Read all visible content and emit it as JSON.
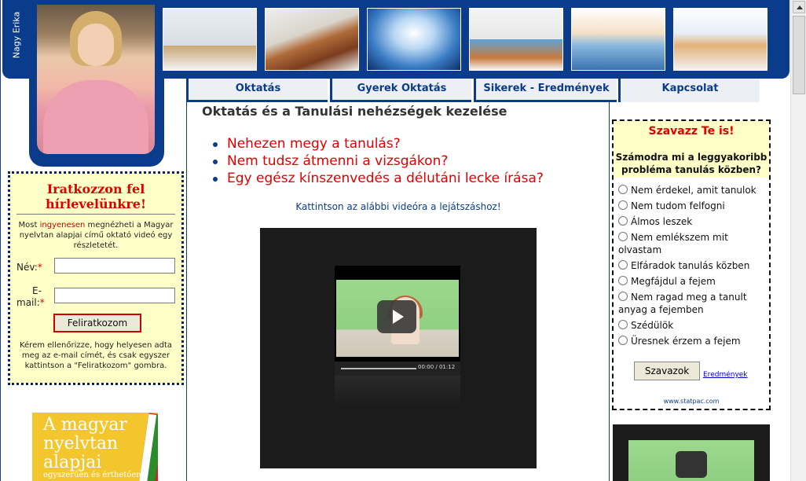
{
  "header": {
    "author_name": "Nagy Erika",
    "photos": [
      "child-frustrated-photo",
      "student-asleep-on-books-photo",
      "glowing-open-book-photo",
      "kids-reading-photo",
      "girl-smiling-with-books-photo",
      "kids-drawing-photo"
    ]
  },
  "nav": {
    "items": [
      {
        "label": "Oktatás"
      },
      {
        "label": "Gyerek Oktatás"
      },
      {
        "label": "Sikerek - Eredmények"
      },
      {
        "label": "Kapcsolat"
      }
    ]
  },
  "newsletter": {
    "title": "Iratkozzon fel hírlevelünkre!",
    "intro_before": "Most ",
    "intro_highlight": "ingyenesen",
    "intro_after": " megnézheti a Magyar nyelvtan alapjai című oktató videó egy részletetét.",
    "name_label": "Név:",
    "email_label_line1": "E-",
    "email_label_line2": "mail:",
    "required_mark": "*",
    "name_value": "",
    "email_value": "",
    "submit_label": "Feliratkozom",
    "note": "Kérem ellenőrizze, hogy helyesen adta meg az e-mail címét, és csak egyszer kattintson a \"Feliratkozom\" gombra."
  },
  "book": {
    "title": "A magyar nyelvtan alapjai",
    "subtitle": "egyszerűen és érthetően"
  },
  "main": {
    "title": "Oktatás és a Tanulási nehézségek kezelése",
    "questions": [
      "Nehezen megy a tanulás?",
      "Nem tudsz átmenni a vizsgákon?",
      "Egy egész kínszenvedés a délutáni lecke írása?"
    ],
    "video_note": "Kattintson az alábbi videóra a lejátszáshoz!",
    "player_time": "00:00 / 01:12"
  },
  "poll": {
    "heading": "Szavazz Te is!",
    "question": "Számodra mi a leggyakoribb probléma tanulás közben?",
    "options": [
      "Nem érdekel, amit tanulok",
      "Nem tudom felfogni",
      "Álmos leszek",
      "Nem emlékszem mit olvastam",
      "Elfáradok tanulás közben",
      "Megfájdul a fejem",
      "Nem ragad meg a tanult anyag a fejemben",
      "Szédülök",
      "Üresnek érzem a fejem"
    ],
    "vote_label": "Szavazok",
    "results_link": "Eredmények",
    "credit": "www.statpac.com"
  },
  "colors": {
    "brand_blue": "#0b3c8c",
    "accent_red": "#e00000",
    "panel_yellow": "#ffffc8"
  }
}
